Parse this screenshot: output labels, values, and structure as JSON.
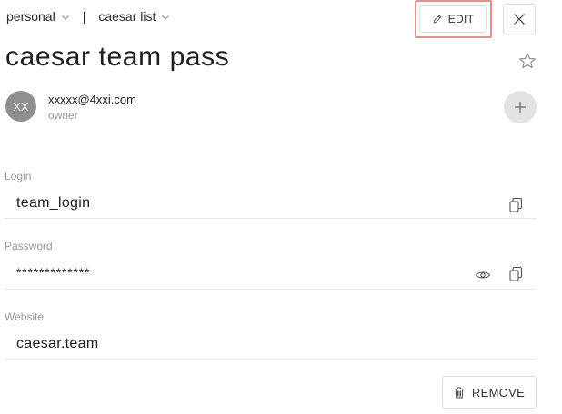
{
  "header": {
    "workspace": "personal",
    "separator": "|",
    "list": "caesar list",
    "edit_label": "EDIT"
  },
  "item": {
    "title": "caesar team pass"
  },
  "owner": {
    "initials": "XX",
    "email": "xxxxx@4xxi.com",
    "role": "owner"
  },
  "fields": {
    "login": {
      "label": "Login",
      "value": "team_login"
    },
    "password": {
      "label": "Password",
      "value": "*************"
    },
    "website": {
      "label": "Website",
      "value": "caesar.team"
    }
  },
  "actions": {
    "remove_label": "REMOVE"
  },
  "colors": {
    "highlight": "#f08c8c",
    "avatar_bg": "#8f8f8f",
    "add_bg": "#e3e3e3"
  }
}
